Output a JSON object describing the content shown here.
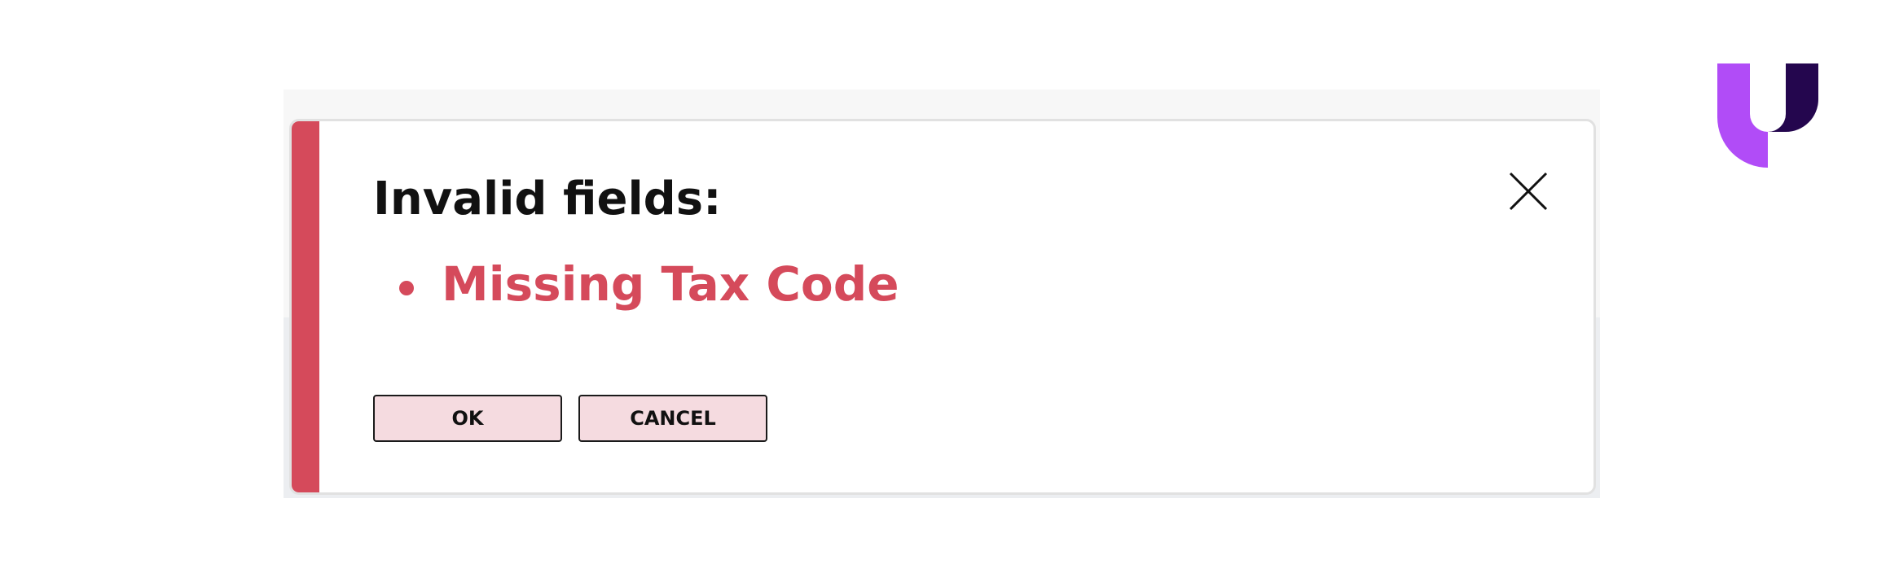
{
  "dialog": {
    "title": "Invalid fields:",
    "errors": [
      "Missing Tax Code"
    ],
    "ok_label": "OK",
    "cancel_label": "CANCEL",
    "close_icon": "close-icon"
  },
  "logo": {
    "icon": "brand-u-logo"
  },
  "colors": {
    "accent_error": "#d54a5b",
    "button_bg": "#f5dbe0",
    "logo_purple": "#b14cf7",
    "logo_dark": "#24064e"
  }
}
